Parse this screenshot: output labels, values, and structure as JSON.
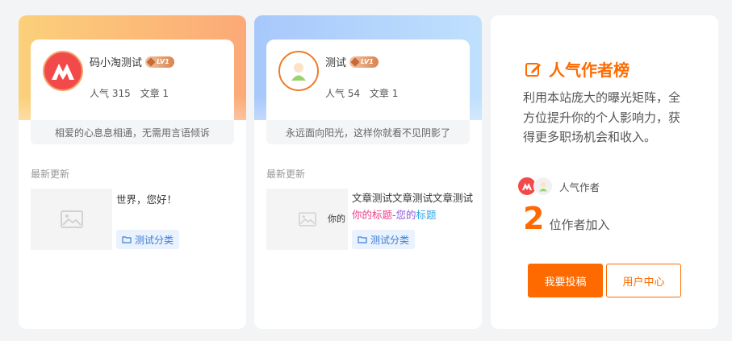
{
  "authors": [
    {
      "name": "码小淘测试",
      "level": "LV1",
      "avatar_icon": "brand-logo-icon",
      "popularity_label": "人气 315",
      "articles_label": "文章 1",
      "motto": "相爱的心息息相通，无需用言语倾诉",
      "latest_label": "最新更新",
      "post": {
        "title": "世界，您好！",
        "category": "测试分类",
        "thumb_text": ""
      }
    },
    {
      "name": "测试",
      "level": "LV1",
      "avatar_icon": "cartoon-avatar-icon",
      "popularity_label": "人气 54",
      "articles_label": "文章 1",
      "motto": "永远面向阳光，这样你就看不见阴影了",
      "latest_label": "最新更新",
      "post": {
        "title_plain": "文章测试文章测试文章测试",
        "title_hl1": "你的标题",
        "title_hl2": "-您的",
        "title_hl3": "标题",
        "thumb_text": "你的",
        "category": "测试分类"
      }
    }
  ],
  "sidebar": {
    "title": "人气作者榜",
    "title_icon": "edit-icon",
    "description": "利用本站庞大的曝光矩阵，全方位提升你的个人影响力，获得更多职场机会和收入。",
    "avatars_label": "人气作者",
    "count": "2",
    "count_suffix": "位作者加入",
    "primary_button": "我要投稿",
    "secondary_button": "用户中心"
  },
  "colors": {
    "accent": "#ff6a00",
    "tag_text": "#3d7ed6",
    "tag_bg": "#e9f2fd"
  }
}
